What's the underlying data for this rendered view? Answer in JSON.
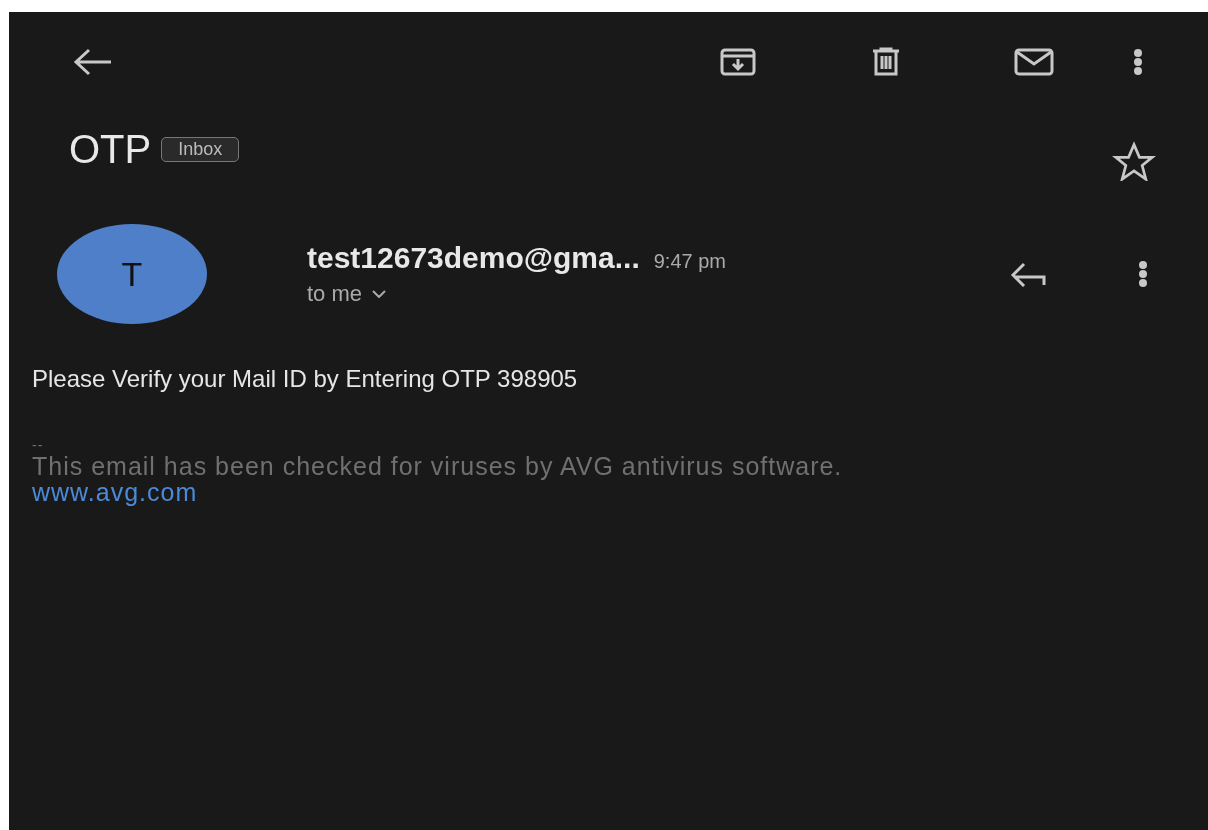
{
  "subject": "OTP",
  "label": "Inbox",
  "starred": false,
  "message": {
    "avatar_letter": "T",
    "sender": "test12673demo@gma...",
    "time": "9:47 pm",
    "recipient": "to me"
  },
  "body": "Please Verify your Mail ID by Entering OTP 398905",
  "signature": {
    "separator": "--",
    "text": "This email has been checked for viruses by AVG antivirus software.",
    "link": "www.avg.com"
  }
}
